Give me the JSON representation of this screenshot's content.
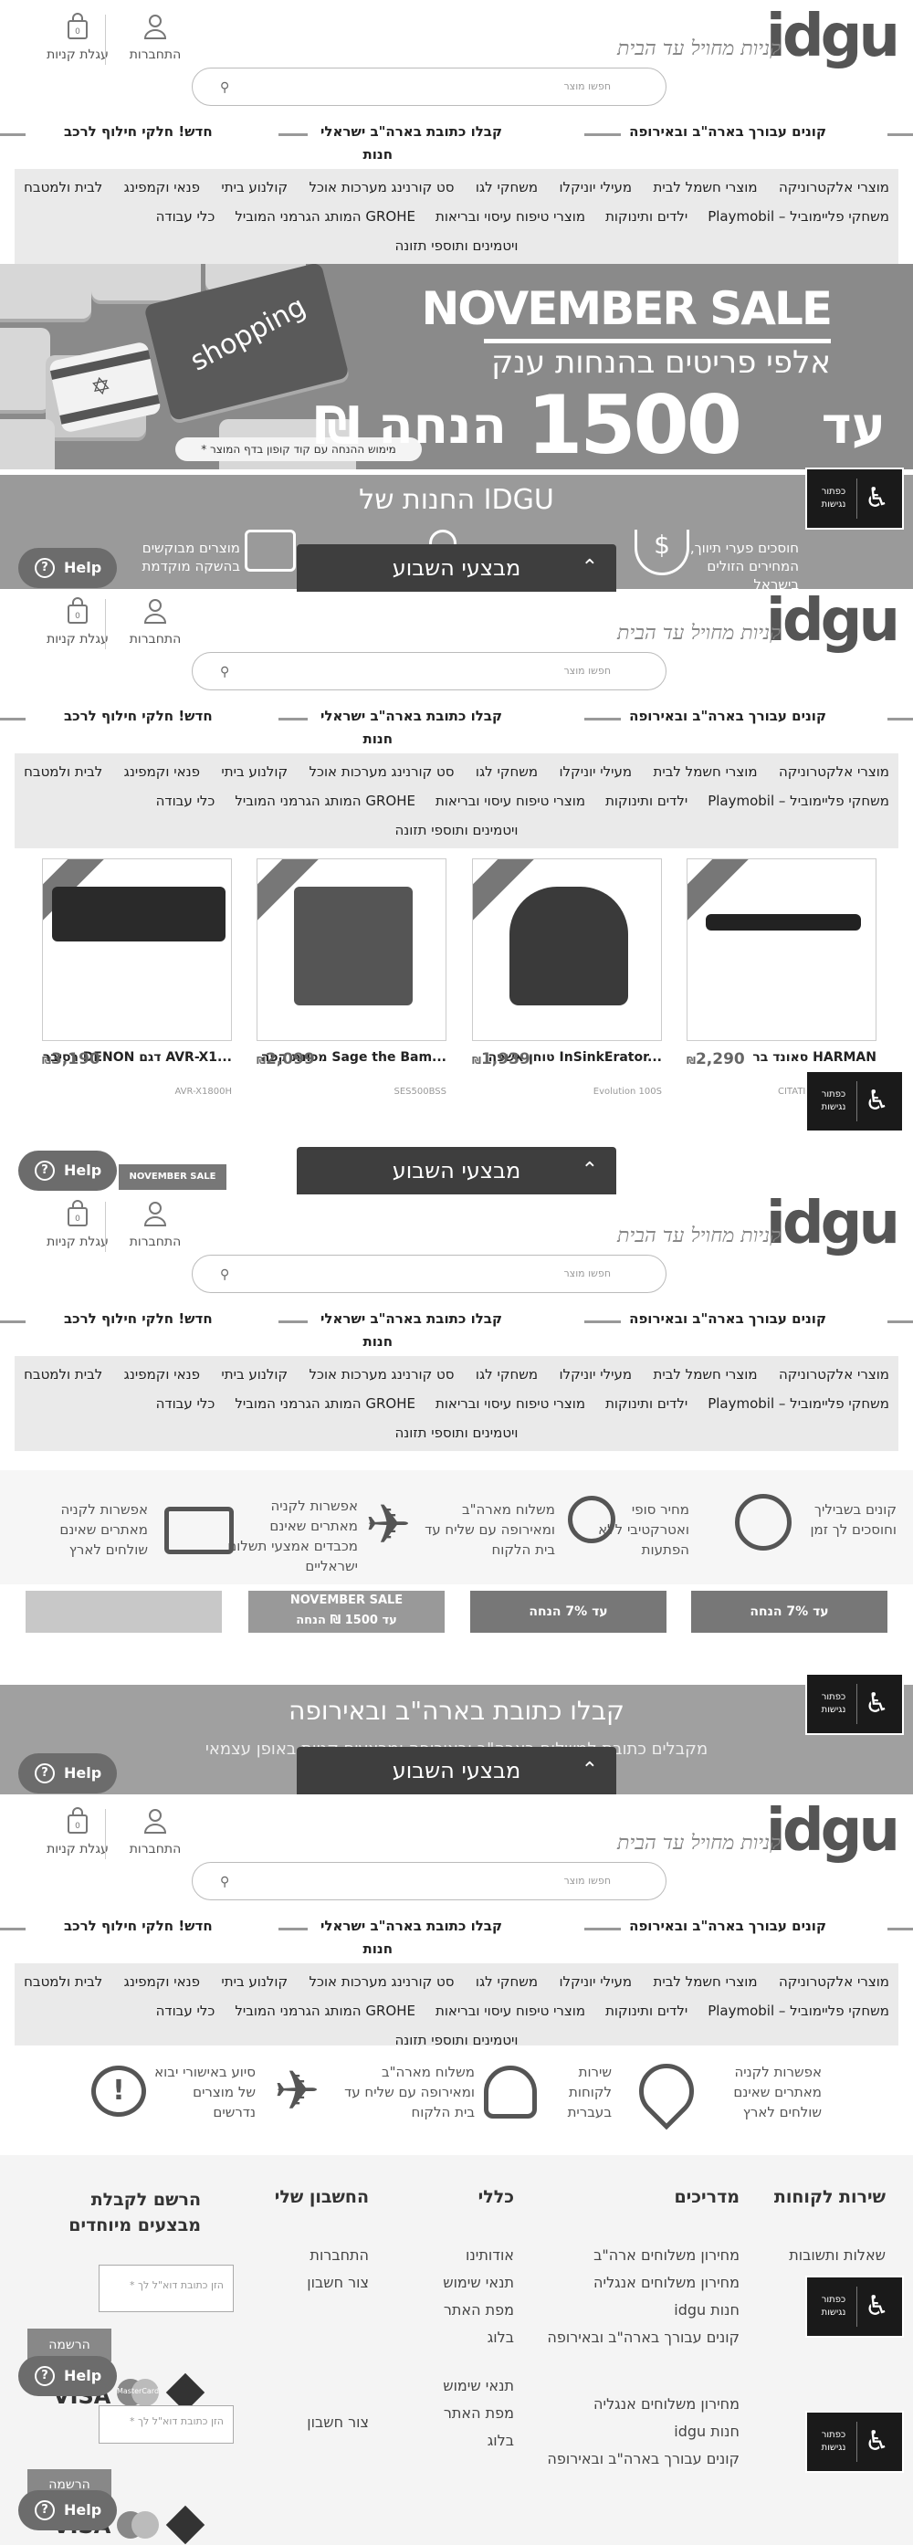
{
  "header": {
    "logo": "idgu",
    "tagline": "קניות מחויל עד הבית",
    "cart_label": "עגלת קניות",
    "cart_count": "0",
    "login_label": "התחברות",
    "search_placeholder": "חפשו מוצר",
    "promos": [
      "קונים עבורך בארה\"ב ובאירופה",
      "קבלו כתובת בארה\"ב ישראלי",
      "חנות",
      "חדש! חלקי חילוף לרכב"
    ]
  },
  "nav": {
    "row1": [
      "מוצרי אלקטרוניקה",
      "מוצרי חשמל לבית",
      "מעילי יוניקלו",
      "משחקי לגו",
      "סט קורנינג מערכות אוכל",
      "קולנוע ביתי",
      "פנאי וקמפינג",
      "לבית ולמטבח"
    ],
    "row2": [
      "משחקי פליימוביל – Playmobil",
      "ילדים ותינוקות",
      "מוצרי טיפוח עיסוי ובריאות",
      "GROHE המותג הגרמני המוביל",
      "כלי עבודה"
    ],
    "row3": "ויטמינים ותוספי תזונה"
  },
  "hero": {
    "title": "NOVEMBER SALE",
    "subtitle": "אלפי פריטים בהנחות ענק",
    "amount_prefix": "עד",
    "amount": "1500",
    "amount_suffix": "₪ הנחה",
    "keycap": "shopping",
    "disclaimer": "* מימוש ההנחה עם קוד קופון בדף המוצר"
  },
  "store_section": {
    "title": "החנות של IDGU",
    "benefit_right": "חוסכים פערי תיווך, המחירים הזולים בישראל",
    "benefit_left": "מוצרים מבוקשים בהשקה מוקדמת"
  },
  "weekly_deals_label": "מבצעי השבוע",
  "help_label": "Help",
  "accessibility_label": "כפתור נגישות",
  "products": [
    {
      "name": "סאונד בר HARMAN",
      "price": "2,290",
      "sku": "CITATION MULTIBEAM 700",
      "currency": "₪"
    },
    {
      "name": "טוחן אשפה InSinkErator...",
      "price": "1,939",
      "sku": "Evolution 100S",
      "currency": "₪"
    },
    {
      "name": "מכונת קפה Sage the Bam...",
      "price": "2,099",
      "sku": "SES500BSS",
      "currency": "₪"
    },
    {
      "name": "רסיבר DENON דגם AVR-X1...",
      "price": "3,190",
      "sku": "AVR-X1800H",
      "currency": "₪"
    }
  ],
  "product_badge": "NOVEMBER SALE",
  "features_1": [
    "קונים בשביליך וחוסכים לך זמן",
    "מחיר סופי ואטרקטיבי ללא הפתעות",
    "משלוח מארה\"ב ומאירופה עם שליח עד בית הלקוח",
    "אפשרות לקניה מאתרים שאינם מכבדים אמצעי תשלום ישראליים",
    "אפשרות לקניה מאתרים שאינם שולחים לארץ"
  ],
  "banners": [
    "עד 7% הנחה",
    "NOVEMBER SALE",
    "עד 1500 ₪ הנחה"
  ],
  "us_address": {
    "title": "קבלו כתובת בארה\"ב ובאירופה",
    "subtitle": "מקבלים כתובת למשלוח בארה\"ב ובאירופה ומבצעים קניות באופן עצמאי"
  },
  "features_2": [
    "אפשרות לקניה מאתרים שאינם שולחים לארץ",
    "שירות לקוחות בעברית",
    "משלוח מארה\"ב ומאירופה עם שליח עד בית הלקוח",
    "סיוע באישורי יבוא של מוצרים נדרשים"
  ],
  "footer": {
    "col_service_title": "שירות לקוחות",
    "col_service": [
      "שאלות ותשובות"
    ],
    "col_guides_title": "מדריכים",
    "col_guides": [
      "מחירון משלוחים ארה\"ב",
      "מחירון משלוחים אנגליה",
      "idgu חנות",
      "קונים עבורך בארה\"ב ובאירופה"
    ],
    "col_general_title": "כללי",
    "col_general": [
      "אודותינו",
      "תנאי שימוש",
      "מפת האתר",
      "בלוג"
    ],
    "col_account_title": "החשבון שלי",
    "col_account": [
      "התחברות",
      "צור חשבון"
    ],
    "col_newsletter_title": "הרשם לקבלת מבצעים מיוחדים",
    "email_placeholder": "* הזן כתובת דוא\"ל לך",
    "register_button": "הרשמה",
    "payment": [
      "VISA",
      "MasterCard"
    ]
  }
}
